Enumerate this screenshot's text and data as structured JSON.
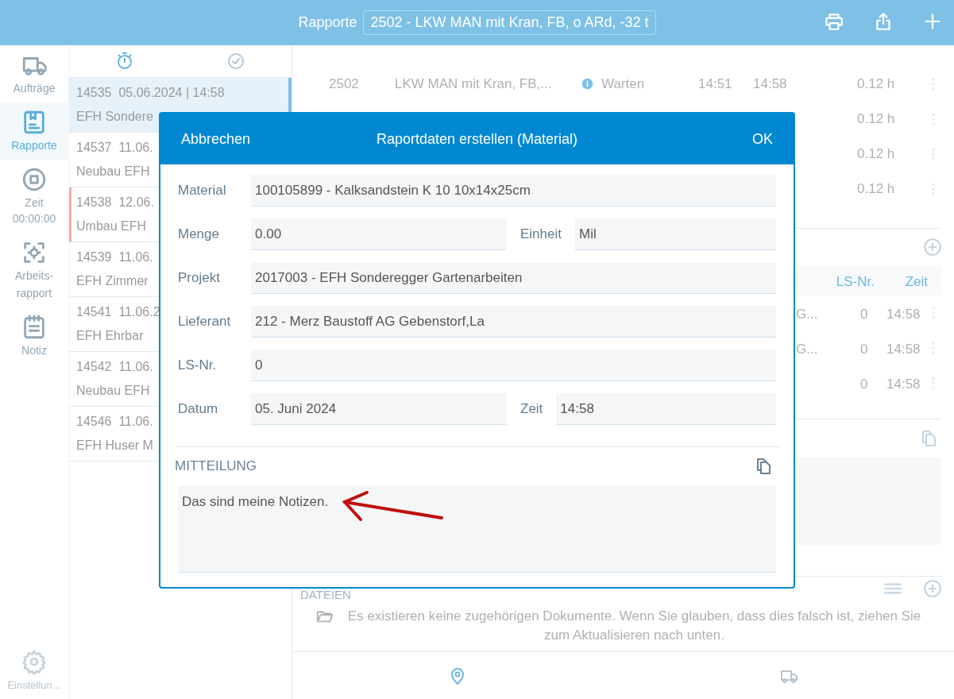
{
  "header": {
    "title": "Rapporte",
    "selector": "2502 - LKW MAN mit Kran, FB, o ARd, -32 t",
    "actions": [
      {
        "kind": "print"
      },
      {
        "kind": "share"
      },
      {
        "kind": "add"
      }
    ]
  },
  "nav": [
    {
      "kind": "truck",
      "label": "Aufträge",
      "selected": false
    },
    {
      "kind": "report",
      "label": "Rapporte",
      "selected": true
    },
    {
      "kind": "timer",
      "label": "Zeit",
      "timer": "00:00:00",
      "selected": false
    },
    {
      "kind": "scan",
      "label": "Arbeits-\nrapport",
      "selected": false
    },
    {
      "kind": "note",
      "label": "Notiz",
      "selected": false
    }
  ],
  "settings": {
    "label": "Einstellun..."
  },
  "report_list": {
    "tabs": [
      {
        "kind": "stopwatch",
        "selected": true
      },
      {
        "kind": "check",
        "selected": false
      }
    ],
    "items": [
      {
        "number": "14535",
        "date": "05.06.2024 | 14:58",
        "name": "EFH Sondere",
        "selected": true,
        "flagged": false
      },
      {
        "number": "14537",
        "date": "11.06.",
        "name": "Neubau EFH",
        "selected": false,
        "flagged": false
      },
      {
        "number": "14538",
        "date": "12.06.",
        "name": "Umbau EFH",
        "selected": false,
        "flagged": true
      },
      {
        "number": "14539",
        "date": "11.06.",
        "name": "EFH Zimmer",
        "selected": false,
        "flagged": false
      },
      {
        "number": "14541",
        "date": "11.06.2",
        "name": "EFH Ehrbar",
        "selected": false,
        "flagged": false
      },
      {
        "number": "14542",
        "date": "11.06.",
        "name": "Neubau EFH",
        "selected": false,
        "flagged": false
      },
      {
        "number": "14546",
        "date": "11.06.",
        "name": "EFH Huser M",
        "selected": false,
        "flagged": false
      }
    ]
  },
  "activities": [
    {
      "number": "2502",
      "description": "LKW MAN mit Kran, FB,...",
      "info": true,
      "status": "Warten",
      "start": "14:51",
      "end": "14:58",
      "duration": "0.12 h"
    },
    {
      "duration": "0.12 h"
    },
    {
      "duration": "0.12 h"
    },
    {
      "duration": "0.12 h"
    }
  ],
  "materials": {
    "columns": [
      "LS-Nr.",
      "Zeit"
    ],
    "rows": [
      {
        "column_1": "G...",
        "ls_nr": "0",
        "time": "14:58"
      },
      {
        "column_1": "G...",
        "ls_nr": "0",
        "time": "14:58"
      },
      {
        "ls_nr": "0",
        "time": "14:58"
      }
    ]
  },
  "files": {
    "title": "DATEIEN",
    "empty_message": "Es existieren keine zugehörigen Dokumente. Wenn Sie glauben, dass dies falsch ist, ziehen Sie zum Aktualisieren nach unten."
  },
  "bottom_tabs": [
    {
      "kind": "location",
      "selected": true
    },
    {
      "kind": "truck",
      "selected": false
    }
  ],
  "dialog": {
    "cancel": "Abbrechen",
    "title": "Raportdaten erstellen (Material)",
    "ok": "OK",
    "rows": [
      [
        {
          "label": "Material",
          "value": "100105899 - Kalksandstein K 10 10x14x25cm"
        }
      ],
      [
        {
          "label": "Menge",
          "value": "0.00"
        },
        {
          "label": "Einheit",
          "value": "Mil"
        }
      ],
      [
        {
          "label": "Projekt",
          "value": "2017003 - EFH Sonderegger Gartenarbeiten"
        }
      ],
      [
        {
          "label": "Lieferant",
          "value": "212 - Merz Baustoff AG Gebenstorf,La"
        }
      ],
      [
        {
          "label": "LS-Nr.",
          "value": "0"
        }
      ],
      [
        {
          "label": "Datum",
          "value": "05. Juni 2024"
        },
        {
          "label": "Zeit",
          "value": "14:58"
        }
      ]
    ],
    "message_title": "MITTEILUNG",
    "message": "Das sind meine Notizen."
  }
}
